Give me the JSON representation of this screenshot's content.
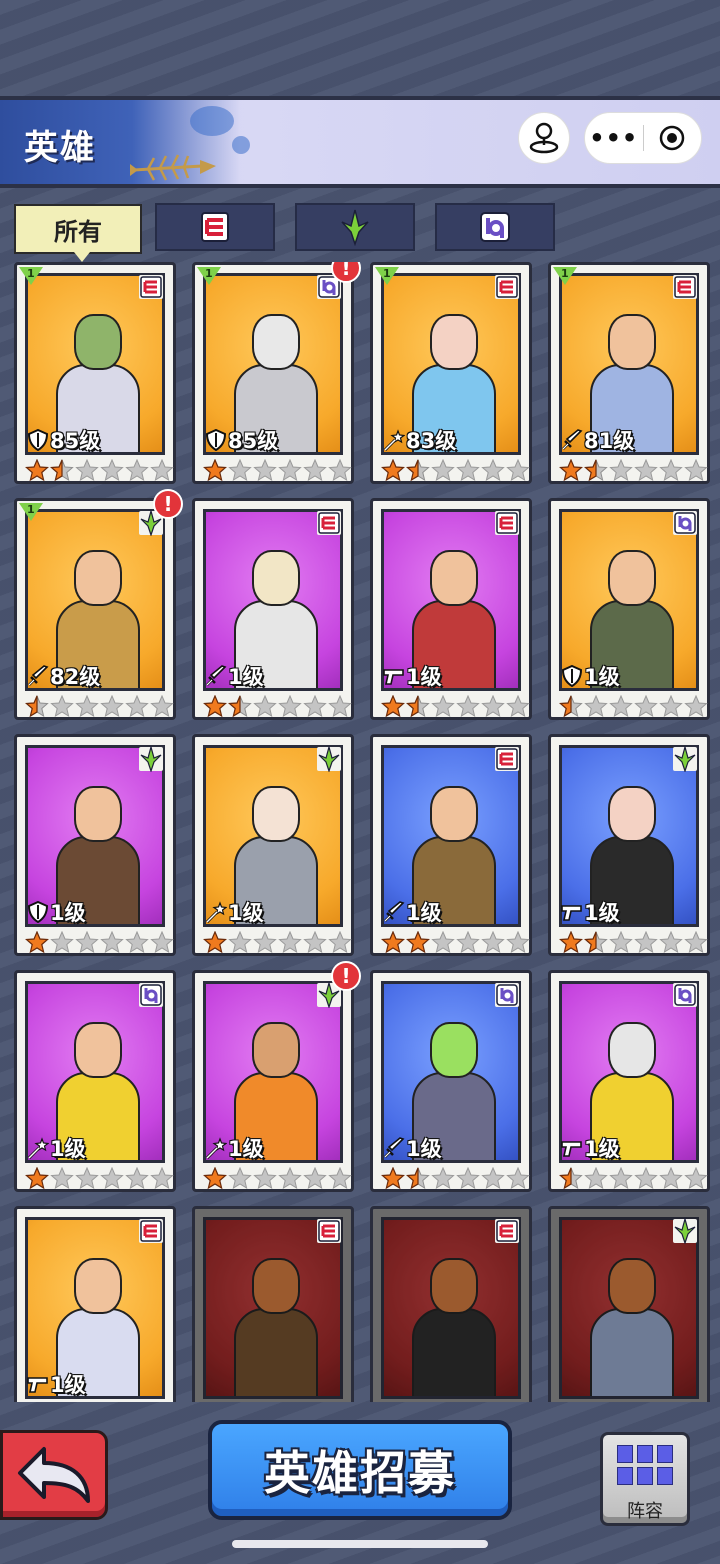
{
  "header": {
    "title": "英雄"
  },
  "filters": [
    {
      "label": "所有",
      "icon": "",
      "active": true
    },
    {
      "label": "",
      "icon": "faction-e-icon",
      "active": false
    },
    {
      "label": "",
      "icon": "faction-dagger-icon",
      "active": false
    },
    {
      "label": "",
      "icon": "faction-bq-icon",
      "active": false
    }
  ],
  "heroes": [
    {
      "level": "85级",
      "class": "shield",
      "faction": "e",
      "bg": "orange",
      "stars": 1.5,
      "badge": "1",
      "alert": false,
      "skin": "#8fb46a",
      "outfit": "#d9d9e8"
    },
    {
      "level": "85级",
      "class": "shield",
      "faction": "bq",
      "bg": "orange",
      "stars": 1,
      "badge": "1",
      "alert": true,
      "skin": "#e8e8e8",
      "outfit": "#c9c9cf"
    },
    {
      "level": "83级",
      "class": "wand",
      "faction": "e",
      "bg": "orange",
      "stars": 1.5,
      "badge": "1",
      "alert": false,
      "skin": "#f4d2c4",
      "outfit": "#7fc6ee"
    },
    {
      "level": "81级",
      "class": "sword",
      "faction": "e",
      "bg": "orange",
      "stars": 1.5,
      "badge": "1",
      "alert": false,
      "skin": "#f0c29c",
      "outfit": "#9fb4e2"
    },
    {
      "level": "82级",
      "class": "sword",
      "faction": "dagger",
      "bg": "orange",
      "stars": 0.5,
      "badge": "1",
      "alert": true,
      "skin": "#f0c29c",
      "outfit": "#c99c4a"
    },
    {
      "level": "1级",
      "class": "sword",
      "faction": "e",
      "bg": "purple",
      "stars": 1.5,
      "badge": "",
      "alert": false,
      "skin": "#f2e6c6",
      "outfit": "#e6e6e6"
    },
    {
      "level": "1级",
      "class": "gun",
      "faction": "e",
      "bg": "purple",
      "stars": 1.5,
      "badge": "",
      "alert": false,
      "skin": "#f0c29c",
      "outfit": "#c03a3a"
    },
    {
      "level": "1级",
      "class": "shield",
      "faction": "bq",
      "bg": "orange",
      "stars": 0.5,
      "badge": "",
      "alert": false,
      "skin": "#f0c29c",
      "outfit": "#5c6a4a"
    },
    {
      "level": "1级",
      "class": "shield",
      "faction": "dagger",
      "bg": "purple",
      "stars": 1,
      "badge": "",
      "alert": false,
      "skin": "#f0c29c",
      "outfit": "#6b4a34"
    },
    {
      "level": "1级",
      "class": "wand",
      "faction": "dagger",
      "bg": "orange",
      "stars": 1,
      "badge": "",
      "alert": false,
      "skin": "#f4e2d4",
      "outfit": "#9aa0ac"
    },
    {
      "level": "1级",
      "class": "sword",
      "faction": "e",
      "bg": "blue",
      "stars": 2,
      "badge": "",
      "alert": false,
      "skin": "#f0c29c",
      "outfit": "#8a6a3a"
    },
    {
      "level": "1级",
      "class": "gun",
      "faction": "dagger",
      "bg": "blue",
      "stars": 1.5,
      "badge": "",
      "alert": false,
      "skin": "#f4d2c4",
      "outfit": "#2a2a2a"
    },
    {
      "level": "1级",
      "class": "wand",
      "faction": "bq",
      "bg": "purple",
      "stars": 1,
      "badge": "",
      "alert": false,
      "skin": "#f0c29c",
      "outfit": "#f0d030"
    },
    {
      "level": "1级",
      "class": "wand",
      "faction": "dagger",
      "bg": "purple",
      "stars": 1,
      "badge": "",
      "alert": true,
      "skin": "#d9a070",
      "outfit": "#f08a2a"
    },
    {
      "level": "1级",
      "class": "sword",
      "faction": "bq",
      "bg": "blue",
      "stars": 1.5,
      "badge": "",
      "alert": false,
      "skin": "#9ae060",
      "outfit": "#6a6a8a"
    },
    {
      "level": "1级",
      "class": "gun",
      "faction": "bq",
      "bg": "purple",
      "stars": 0.5,
      "badge": "",
      "alert": false,
      "skin": "#e6e6e6",
      "outfit": "#f0d030"
    },
    {
      "level": "1级",
      "class": "gun",
      "faction": "e",
      "bg": "orange",
      "stars": 0,
      "badge": "",
      "alert": false,
      "skin": "#f0c29c",
      "outfit": "#d9dcf0"
    },
    {
      "level": "",
      "class": "",
      "faction": "e",
      "bg": "red",
      "stars": 0,
      "badge": "",
      "alert": false,
      "skin": "#c2703a",
      "outfit": "#6a4a2a"
    },
    {
      "level": "",
      "class": "",
      "faction": "e",
      "bg": "red",
      "stars": 0,
      "badge": "",
      "alert": false,
      "skin": "#c2703a",
      "outfit": "#2a2a2a"
    },
    {
      "level": "",
      "class": "",
      "faction": "dagger",
      "bg": "red",
      "stars": 0,
      "badge": "",
      "alert": false,
      "skin": "#c2703a",
      "outfit": "#8a9aba"
    }
  ],
  "buttons": {
    "recruit": "英雄招募",
    "lineup": "阵容"
  },
  "colors": {
    "accent_blue": "#3f86f0",
    "back_red": "#e23d45",
    "star_orange": "#f07a1e"
  }
}
